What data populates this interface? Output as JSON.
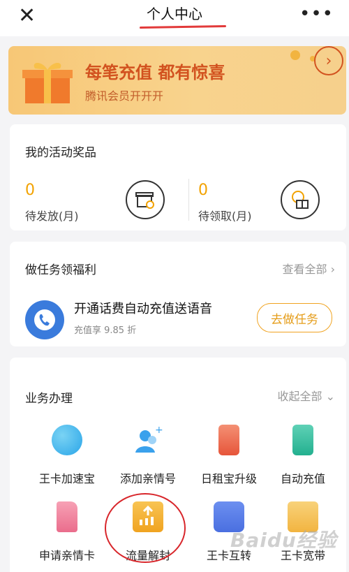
{
  "topbar": {
    "close_icon": "close-icon",
    "title": "个人中心",
    "more_icon": "more-dots-icon"
  },
  "banner": {
    "main": "每笔充值 都有惊喜",
    "sub": "腾讯会员开开开",
    "icons": [
      "gift-box-icon",
      "arrow-circle-icon"
    ],
    "colors": {
      "text": "#d2521f",
      "bg": "#f7c776"
    }
  },
  "awards": {
    "title": "我的活动奖品",
    "items": [
      {
        "count": "0",
        "label": "待发放(月)",
        "icon": "gift-pending-icon"
      },
      {
        "count": "0",
        "label": "待领取(月)",
        "icon": "gift-claim-icon"
      }
    ],
    "accent": "#f2a200"
  },
  "tasks": {
    "title": "做任务领福利",
    "see_all": "查看全部",
    "item": {
      "icon": "phone-call-icon",
      "title": "开通话费自动充值送语音",
      "sub": "充值享 9.85 折",
      "button": "去做任务"
    }
  },
  "services": {
    "title": "业务办理",
    "collapse": "收起全部",
    "items": [
      {
        "label": "王卡加速宝",
        "icon": "speed-globe-icon"
      },
      {
        "label": "添加亲情号",
        "icon": "add-family-icon"
      },
      {
        "label": "日租宝升级",
        "icon": "phone-rent-icon"
      },
      {
        "label": "自动充值",
        "icon": "auto-recharge-icon"
      },
      {
        "label": "申请亲情卡",
        "icon": "sim-card-icon"
      },
      {
        "label": "流量解封",
        "icon": "data-unlock-icon"
      },
      {
        "label": "王卡互转",
        "icon": "card-transfer-icon"
      },
      {
        "label": "王卡宽带",
        "icon": "broadband-icon"
      }
    ]
  },
  "watermark": "Baidu经验"
}
